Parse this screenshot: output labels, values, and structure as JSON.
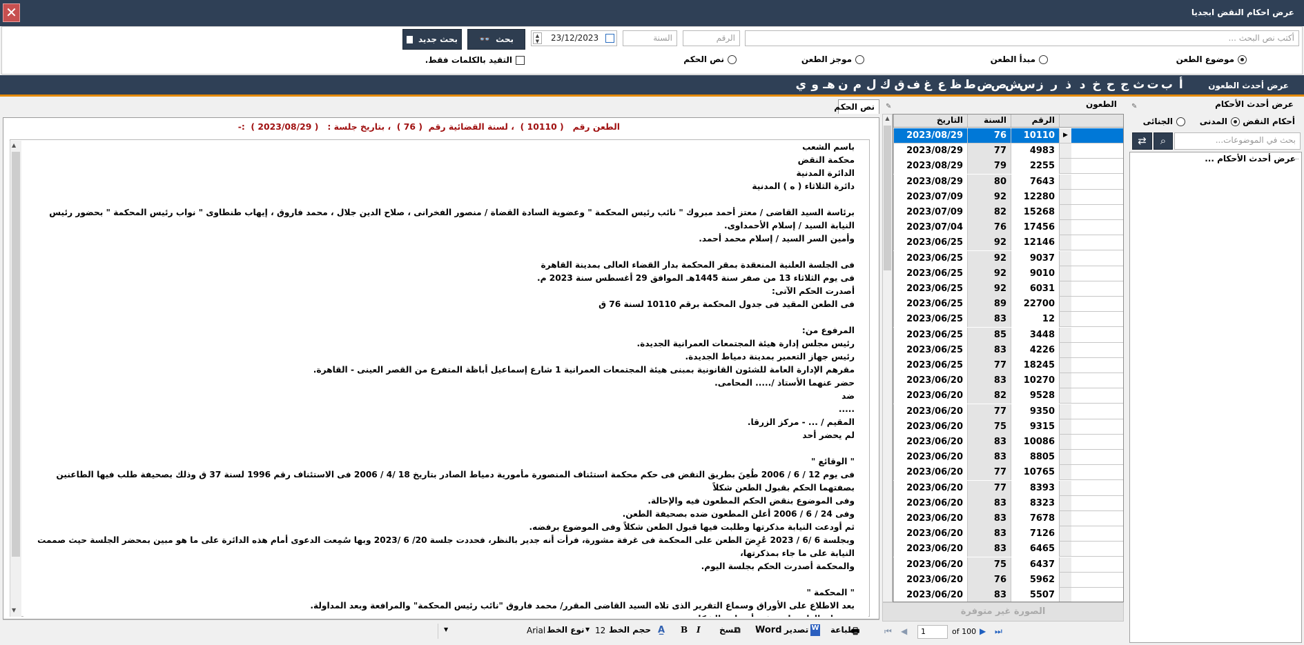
{
  "window": {
    "title": "عرض احكام النقض ابجديا",
    "close_glyph": "✕"
  },
  "search": {
    "text_placeholder": "أكتب نص البحث ...",
    "number_placeholder": "الرقم",
    "year_placeholder": "السنة",
    "date_value": "23/12/2023",
    "search_label": "بحث",
    "new_search_label": "بحث جديد",
    "radios": [
      {
        "label": "موضوع الطعن",
        "checked": true
      },
      {
        "label": "مبدأ الطعن",
        "checked": false
      },
      {
        "label": "موجز الطعن",
        "checked": false
      },
      {
        "label": "نص الحكم",
        "checked": false
      }
    ],
    "exact_words_label": "التقيد بالكلمات فقط."
  },
  "alphabet": {
    "title": "عرض أحدث الطعون",
    "letters": [
      "أ",
      "ب",
      "ت",
      "ث",
      "ج",
      "ح",
      "خ",
      "د",
      "ذ",
      "ر",
      "ز",
      "س",
      "ش",
      "ص",
      "ض",
      "ط",
      "ظ",
      "ع",
      "غ",
      "ف",
      "ق",
      "ك",
      "ل",
      "م",
      "ن",
      "هـ",
      "و",
      "ي"
    ]
  },
  "left_panel": {
    "header": "عرض أحدث الأحكام",
    "type_label": "أحكام النقض",
    "types": [
      {
        "label": "المدنى",
        "checked": true
      },
      {
        "label": "الجنائى",
        "checked": false
      }
    ],
    "search_placeholder": "بحث في الموضوعات...",
    "tree_item": "عرض أحدث الأحكام ..."
  },
  "grid": {
    "header": "الطعون",
    "columns": [
      "الرقم",
      "السنة",
      "التاريخ"
    ],
    "rows": [
      [
        "10110",
        "76",
        "2023/08/29"
      ],
      [
        "4983",
        "77",
        "2023/08/29"
      ],
      [
        "2255",
        "79",
        "2023/08/29"
      ],
      [
        "7643",
        "80",
        "2023/08/29"
      ],
      [
        "12280",
        "92",
        "2023/07/09"
      ],
      [
        "15268",
        "82",
        "2023/07/09"
      ],
      [
        "17456",
        "76",
        "2023/07/04"
      ],
      [
        "12146",
        "92",
        "2023/06/25"
      ],
      [
        "9037",
        "92",
        "2023/06/25"
      ],
      [
        "9010",
        "92",
        "2023/06/25"
      ],
      [
        "6031",
        "92",
        "2023/06/25"
      ],
      [
        "22700",
        "89",
        "2023/06/25"
      ],
      [
        "12",
        "83",
        "2023/06/25"
      ],
      [
        "3448",
        "85",
        "2023/06/25"
      ],
      [
        "4226",
        "83",
        "2023/06/25"
      ],
      [
        "18245",
        "77",
        "2023/06/25"
      ],
      [
        "10270",
        "83",
        "2023/06/20"
      ],
      [
        "9528",
        "82",
        "2023/06/20"
      ],
      [
        "9350",
        "77",
        "2023/06/20"
      ],
      [
        "9315",
        "75",
        "2023/06/20"
      ],
      [
        "10086",
        "83",
        "2023/06/20"
      ],
      [
        "8805",
        "83",
        "2023/06/20"
      ],
      [
        "10765",
        "77",
        "2023/06/20"
      ],
      [
        "8393",
        "77",
        "2023/06/20"
      ],
      [
        "8323",
        "83",
        "2023/06/20"
      ],
      [
        "7678",
        "83",
        "2023/06/20"
      ],
      [
        "7126",
        "83",
        "2023/06/20"
      ],
      [
        "6465",
        "83",
        "2023/06/20"
      ],
      [
        "6437",
        "75",
        "2023/06/20"
      ],
      [
        "5962",
        "76",
        "2023/06/20"
      ],
      [
        "5507",
        "83",
        "2023/06/20"
      ]
    ],
    "selected_index": 0,
    "image_unavailable": "الصورة غير متوفرة",
    "pager": {
      "page": "1",
      "of_label": "of 100"
    }
  },
  "judgment": {
    "tab_label": "نص الحكم",
    "heading": "الطعن رقم   ( 10110 )  ، لسنة القضائية رقم  ( 76 )  ، بتاريخ جلسة :   ( 2023/08/29 )  :-",
    "text": "باسم الشعب\nمحكمة النقض\nالدائرة المدنية\nدائرة الثلاثاء ( ه ) المدنية\n\nبرئاسة السيد القاضى / معتز أحمد مبروك \" نائب رئيس المحكمة \" وعضوية السادة القضاة / منصور الفخرانى ، صلاح الدين جلال ، محمد فاروق ، إيهاب طنطاوى \" نواب رئيس المحكمة \" بحضور رئيس النيابة السيد / إسلام الأحمداوى.\nوأمين السر السيد / إسلام محمد أحمد.\n\nفى الجلسة العلنية المنعقدة بمقر المحكمة بدار القضاء العالى بمدينة القاهرة\nفى يوم الثلاثاء 13 من صفر سنة 1445هـ الموافق 29 أغسطس سنة 2023 م.\nأصدرت الحكم الآتى:\nفى الطعن المقيد فى جدول المحكمة برقم 10110 لسنة 76 ق\n\nالمرفوع من:\nرئيس مجلس إدارة هيئة المجتمعات العمرانية الجديدة.\nرئيس جهاز التعمير بمدينة دمياط الجديدة.\nمقرهم الإدارة العامة للشئون القانونية بمبنى هيئة المجتمعات العمرانية 1 شارع إسماعيل أباظة المتفرع من القصر العينى - القاهرة.\nحضر عنهما الأستاذ /..... المحامى.\nضد\n.....\nالمقيم / ... - مركز الزرقا.\nلم يحضر أحد\n\n\" الوقائع \"\nفى يوم 12 / 6 / 2006 طُعِنَ بطريق النقض فى حكم محكمة استئناف المنصورة مأمورية دمياط الصادر بتاريخ 18 /4 / 2006 فى الاستئناف رقم 1996 لسنة 37 ق وذلك بصحيفة طلب فيها الطاعنين بصفتهما الحكم بقبول الطعن شكلاً\nوفى الموضوع بنقض الحكم المطعون فيه والإحالة.\nوفى 24 / 6 / 2006 أعلن المطعون ضده بصحيفة الطعن.\nثم أودعت النيابة مذكرتها وطلبت فيها قبول الطعن شكلاً وفى الموضوع برفضه.\nوبجلسة 6 /6 / 2023 عُرِضَ الطعن على المحكمة فى غرفة مشورة، فرأت أنه جدير بالنظر، فحددت جلسة 20/ 6 /2023 وبها سُمِعت الدعوى أمام هذه الدائرة على ما هو مبين بمحضر الجلسة حيث صممت النيابة على ما جاء بمذكرتها،\nوالمحكمة أصدرت الحكم بجلسة اليوم.\n\n\" المحكمة \"\nبعد الاطلاع على الأوراق وسماع التقرير الذى تلاه السيد القاضى المقرر/ محمد فاروق \"نائب رئيس المحكمة\" والمرافعة وبعد المداولة.\nحيث إن الطعن استوفى أوضاعه الشكلية.\nوحيث إن الوقائع - على ما يبين من الحكم المطعون فيه وسائر الأوراق - تتحصل فى أن المطعون ضده أقام على الطاعنين بصفتيهما الدعوى رقم 766 لسنة 2003 محكمة دمياط الابتدائية مأمورية رأس البر- بطلب الحكم بعدم الاعتداد\nبقرار إلغاء التخصيص الصادر له بتاريخ 6 / 8 / 2000 واعتباره كأن لم يكن ، وبأحقيته فى الوحدة المبينة بالصحيفة ومنع تعرضهما له فيها ، على سند من أنه تقدم لحجز الوحدة السكنية محل التداعى وسدد مبلغ 2800 جنيه وتم إخطاره"
  },
  "toolbar": {
    "print": "طباعة",
    "export": "تصدير",
    "word": "Word",
    "copy": "نسخ",
    "bold": "B",
    "italic": "I",
    "font_size_label": "حجم الخط",
    "font_size": "12",
    "font_name_label": "نوع الخط",
    "font_name": "Arial"
  }
}
